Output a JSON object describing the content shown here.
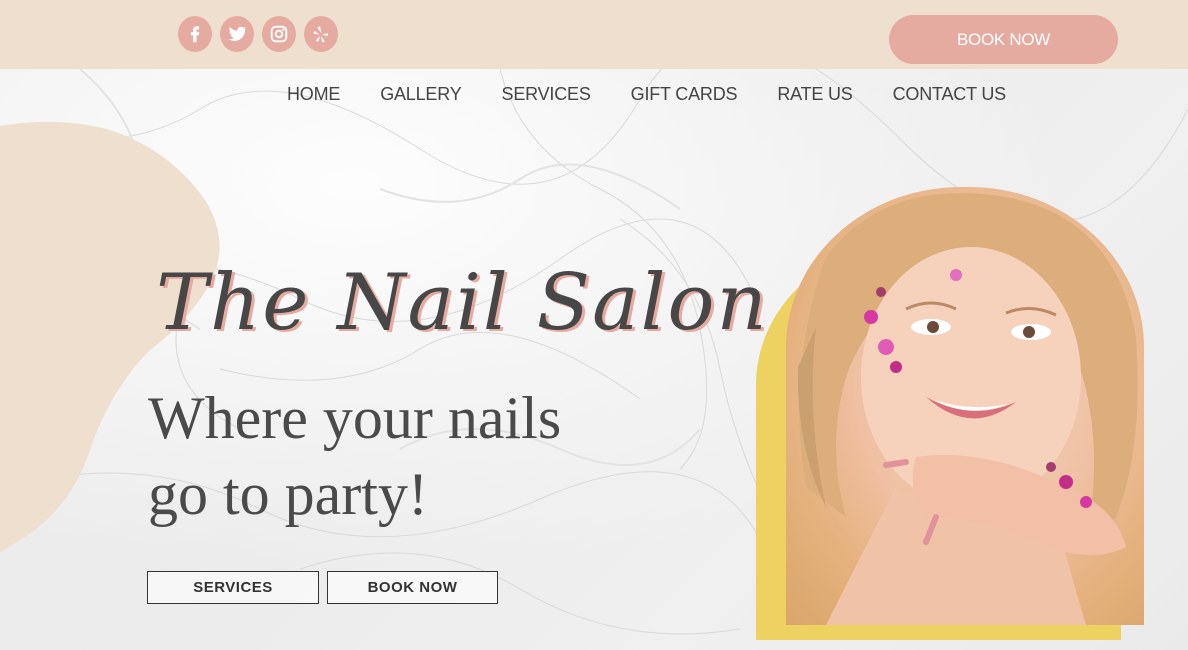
{
  "header": {
    "social": [
      {
        "name": "facebook",
        "icon": "facebook-icon"
      },
      {
        "name": "twitter",
        "icon": "twitter-icon"
      },
      {
        "name": "instagram",
        "icon": "instagram-icon"
      },
      {
        "name": "yelp",
        "icon": "yelp-icon"
      }
    ],
    "book_now_label": "BOOK NOW"
  },
  "nav": {
    "items": [
      "HOME",
      "GALLERY",
      "SERVICES",
      "GIFT CARDS",
      "RATE US",
      "CONTACT US"
    ]
  },
  "hero": {
    "title": "The Nail Salon",
    "tagline_line1": "Where your nails",
    "tagline_line2": "go to party!",
    "services_button": "SERVICES",
    "book_button": "BOOK NOW"
  },
  "colors": {
    "topbar": "#efdfcf",
    "accent_pink": "#e6aba0",
    "arch_yellow": "#edd262",
    "text_dark": "#474747"
  },
  "image": {
    "icon": "woman-portrait-image"
  }
}
